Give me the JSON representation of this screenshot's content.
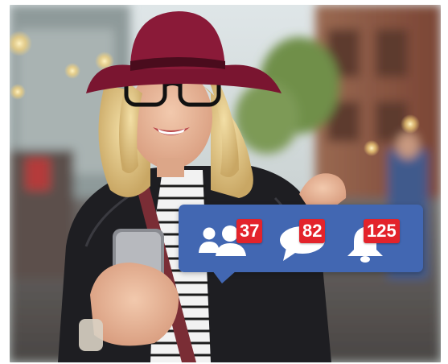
{
  "notifications": {
    "friends": {
      "icon": "friends-icon",
      "count": "37"
    },
    "messages": {
      "icon": "chat-bubble-icon",
      "count": "82"
    },
    "alerts": {
      "icon": "bell-icon",
      "count": "125"
    }
  },
  "colors": {
    "bubble": "#4267b2",
    "badge": "#e3232b",
    "hat": "#7a1530",
    "jacket": "#1e1e22"
  }
}
